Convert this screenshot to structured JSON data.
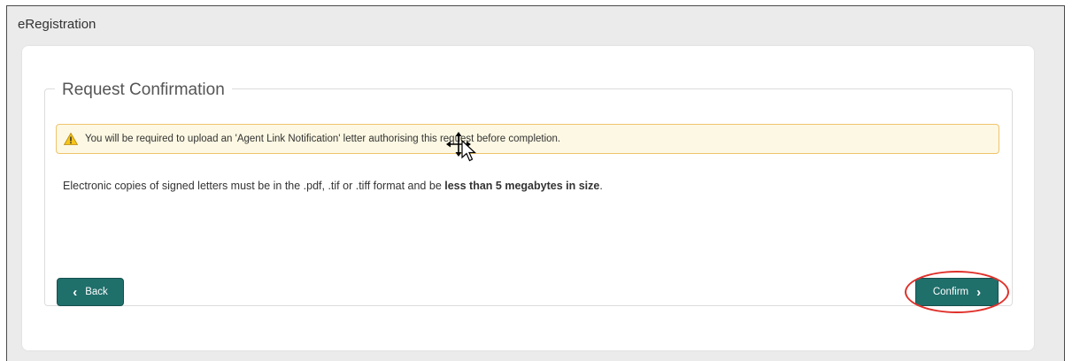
{
  "app": {
    "title": "eRegistration"
  },
  "section": {
    "legend": "Request Confirmation"
  },
  "alert": {
    "icon": "warning-triangle-icon",
    "text": "You will be required to upload an 'Agent Link Notification' letter authorising this request before completion."
  },
  "info": {
    "text_prefix": "Electronic copies of signed letters must be in the .pdf, .tif or .tiff format and be ",
    "text_bold": "less than 5 megabytes in size",
    "text_suffix": "."
  },
  "buttons": {
    "back_label": "Back",
    "confirm_label": "Confirm"
  },
  "colors": {
    "button_teal": "#1f6f6b",
    "alert_bg": "#fcf8e3",
    "alert_border": "#f0c36d",
    "highlight_red": "#e0302a"
  }
}
